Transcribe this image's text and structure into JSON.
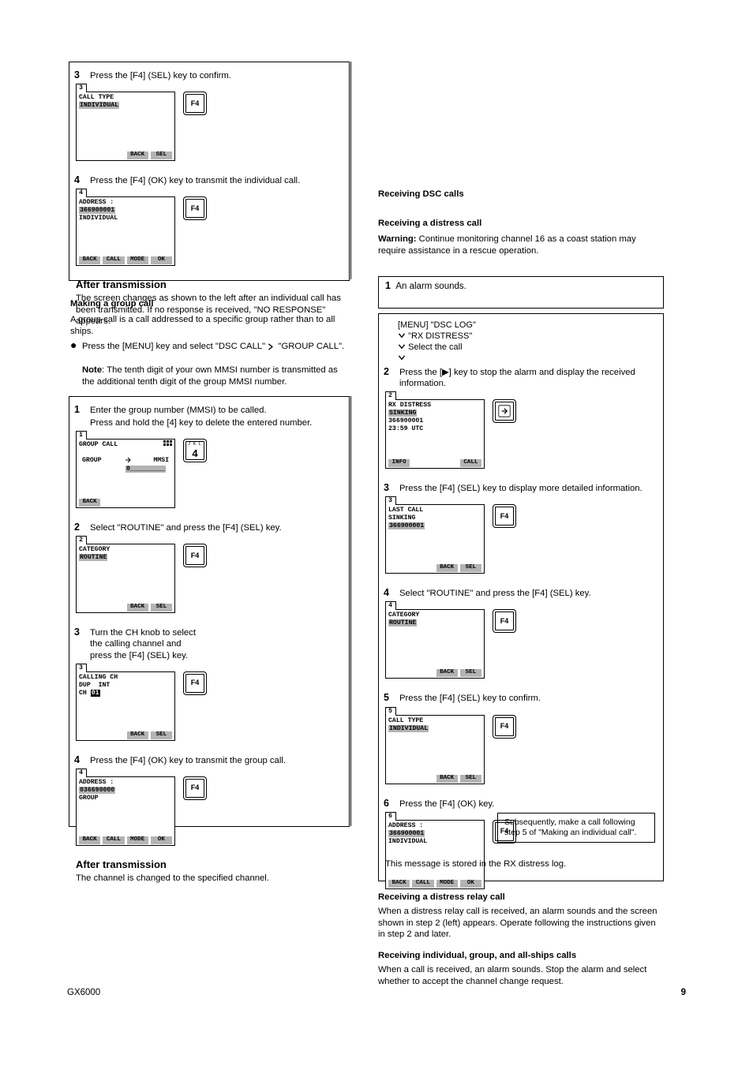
{
  "vdiv": {
    "h1": 276,
    "h2": 545
  },
  "left": {
    "boxA": {
      "headerStep": "3",
      "headerText": "Press the [F4] (SEL) key to confirm.",
      "screen1": {
        "tab": "3",
        "title": "CALL TYPE",
        "line2": "INDIVIDUAL",
        "sk1": "",
        "sk2": "",
        "sk3": "BACK",
        "sk4": "SEL"
      },
      "key1": "F4",
      "step4num": "4",
      "step4text": "Press the [F4] (OK) key to transmit the individual call.",
      "screen2": {
        "tab": "4",
        "line1": "ADDRESS :",
        "line2": "366900001",
        "line3": "INDIVIDUAL",
        "sk1": "BACK",
        "sk2": "CALL",
        "sk3": "MODE",
        "sk4": "OK"
      },
      "key2": "F4",
      "postTitle1": "After transmission",
      "postText1": "The screen changes as shown to the left after an individual call has been transmitted. If no response is received, \"NO RESPONSE\" appears."
    },
    "mid": {
      "noteHead": "Note",
      "noteBody": "The tenth digit of your own MMSI number is transmitted as the additional tenth digit of the group MMSI number."
    },
    "boxB": {
      "step1num": "1",
      "step1text1": "Enter the group number (MMSI) to be called.",
      "step1text2": "Press and hold the [4] key to delete the entered number.",
      "screen1": {
        "tab": "1",
        "title": "GROUP CALL",
        "entry": "0_________",
        "colL": "GROUP",
        "colR": "MMSI",
        "sk": "BACK"
      },
      "key1top": "J K L",
      "key1main": "4",
      "step2num": "2",
      "step2text": "Select \"ROUTINE\" and press the [F4] (SEL) key.",
      "screen2": {
        "tab": "2",
        "title": "CATEGORY",
        "line2": "ROUTINE",
        "sk3": "BACK",
        "sk4": "SEL"
      },
      "key2": "F4",
      "step3num": "3",
      "step3pre": "Turn the CH knob to select",
      "step3line": "the calling channel and",
      "step3tail": "press the [F4] (SEL) key.",
      "screen3": {
        "tab": "3",
        "title": "CALLING CH",
        "l1": "DUP  INT",
        "l2a": "CH",
        "l2b": "01",
        "sk3": "BACK",
        "sk4": "SEL"
      },
      "key3": "F4",
      "step4num": "4",
      "step4text": "Press the [F4] (OK) key to transmit the group call.",
      "screen4": {
        "tab": "4",
        "line1": "ADDRESS :",
        "line2": "036690000",
        "line3": "GROUP",
        "sk1": "BACK",
        "sk2": "CALL",
        "sk3": "MODE",
        "sk4": "OK"
      },
      "key4": "F4",
      "postTitle": "After transmission",
      "postText": "The channel is changed to the specified channel."
    },
    "sec": {
      "h1": "Making a group call",
      "p1": "A group call is a call addressed to a specific group rather than to all ships.",
      "p2a": "Press the [MENU] key and select \"DSC CALL\"  ",
      "p2b": "\"GROUP CALL\"."
    }
  },
  "right": {
    "h1": "Receiving DSC calls",
    "h2": "Receiving a distress call",
    "warnLead": "Warning:",
    "warnBody": " Continue monitoring channel 16 as a coast station may require assistance in a rescue operation.",
    "box": {
      "titleNum": "1",
      "titleText": "An alarm sounds.",
      "route1": "[MENU]    \"DSC LOG\"",
      "route2": "  \"RX DISTRESS\"",
      "route3": "  Select the call",
      "step2num": "2",
      "step2text": "Press the [▶] key to stop the alarm and display the received information.",
      "screen1": {
        "tab": "2",
        "l1": "RX DISTRESS",
        "l2": "SINKING",
        "l3": "366900001",
        "l4": "23:59 UTC",
        "skL": "INFO",
        "skR": "CALL"
      },
      "step3num": "3",
      "step3text": "Press the [F4] (SEL) key to display more detailed information.",
      "screen2": {
        "tab": "3",
        "l1": "LAST CALL",
        "l2": "SINKING",
        "l3": "366900001",
        "sk3": "BACK",
        "sk4": "SEL"
      },
      "key2": "F4",
      "step4num": "4",
      "step4text": "Select \"ROUTINE\" and press the [F4] (SEL) key.",
      "screen4": {
        "tab": "4",
        "l1": "CATEGORY",
        "l2": "ROUTINE",
        "sk3": "BACK",
        "sk4": "SEL"
      },
      "key4": "F4",
      "step5num": "5",
      "step5text": "Press the [F4] (SEL) key to confirm.",
      "screen5": {
        "tab": "5",
        "l1": "CALL TYPE",
        "l2": "INDIVIDUAL",
        "sk3": "BACK",
        "sk4": "SEL"
      },
      "key5": "F4",
      "step6num": "6",
      "step6text": "Press the [F4] (OK) key.",
      "screen6": {
        "tab": "6",
        "a": "ADDRESS :",
        "b": "366900001",
        "c": "INDIVIDUAL",
        "sk1": "BACK",
        "sk2": "CALL",
        "sk3": "MODE",
        "sk4": "OK"
      },
      "key6": "F4",
      "note": "Subsequently, make a call following step 5 of \"Making an individual call\".",
      "post": "This message is stored in the RX distress log."
    },
    "tail": {
      "aHead": "Receiving a distress relay call",
      "aBody": "When a distress relay call is received, an alarm sounds and the screen shown in step 2 (left) appears. Operate following the instructions given in step 2 and later.",
      "bHead": "Receiving individual, group, and all-ships calls",
      "bBody": "When a call is received, an alarm sounds. Stop the alarm and select whether to accept the channel change request."
    }
  },
  "footer": {
    "model": "GX6000",
    "page": "9"
  }
}
